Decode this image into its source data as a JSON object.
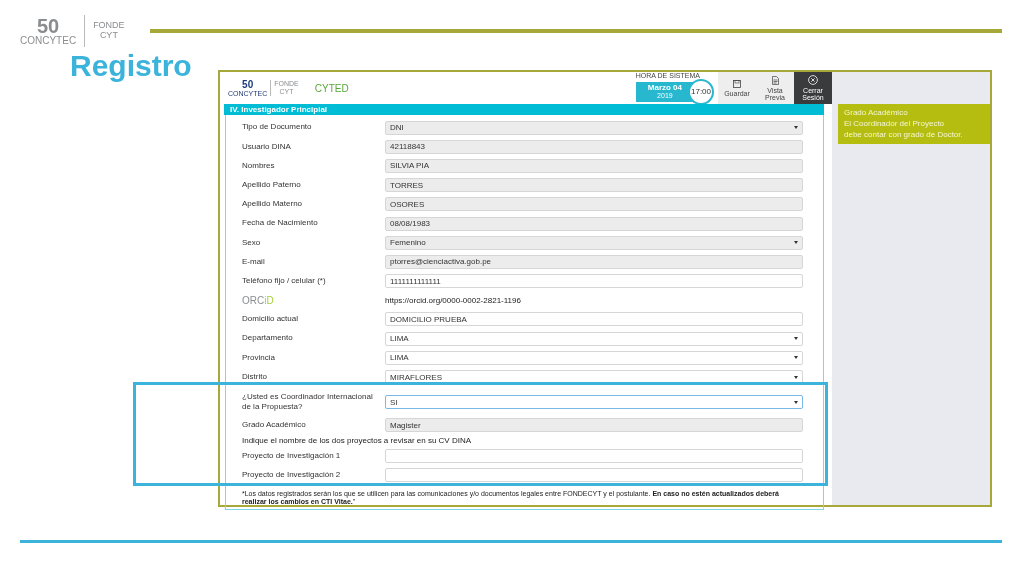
{
  "slide": {
    "logo": {
      "number": "50",
      "name": "CONCYTEC",
      "fund_top": "FONDE",
      "fund_bottom": "CYT"
    },
    "title": "Registro"
  },
  "app": {
    "logos": {
      "number": "50",
      "name": "CONCYTEC",
      "fund_top": "FONDE",
      "fund_bottom": "CYT",
      "partner": "CYTED"
    },
    "clock": {
      "label": "HORA DE SISTEMA",
      "date": "Marzo 04",
      "year": "2019",
      "time": "17:00"
    },
    "toolbar": [
      {
        "kind": "save",
        "label": "Guardar",
        "dark": false
      },
      {
        "kind": "preview",
        "label": "Vista Previa",
        "dark": false
      },
      {
        "kind": "close",
        "label": "Cerrar Sesión",
        "dark": true
      }
    ],
    "section": "IV. Investigador Principial",
    "rows": [
      {
        "kind": "select",
        "label": "Tipo de Documento",
        "value": "DNI",
        "disabled": true
      },
      {
        "kind": "input",
        "label": "Usuario DINA",
        "value": "42118843",
        "disabled": true
      },
      {
        "kind": "input",
        "label": "Nombres",
        "value": "SILVIA PIA",
        "disabled": true
      },
      {
        "kind": "input",
        "label": "Apellido Paterno",
        "value": "TORRES",
        "disabled": true
      },
      {
        "kind": "input",
        "label": "Apellido Materno",
        "value": "OSORES",
        "disabled": true
      },
      {
        "kind": "input",
        "label": "Fecha de Nacimiento",
        "value": "08/08/1983",
        "disabled": true
      },
      {
        "kind": "select",
        "label": "Sexo",
        "value": "Femenino",
        "disabled": true
      },
      {
        "kind": "input",
        "label": "E-mail",
        "value": "ptorres@cienciactiva.gob.pe",
        "disabled": true
      },
      {
        "kind": "input",
        "label": "Teléfono fijo / celular (*)",
        "value": "1111111111111",
        "disabled": false
      },
      {
        "kind": "orcid",
        "label_main": "ORC",
        "label_accent": "iD",
        "value": "https://orcid.org/0000-0002-2821-1196"
      },
      {
        "kind": "input",
        "label": "Domicilio actual",
        "value": "DOMICILIO PRUEBA",
        "disabled": false
      },
      {
        "kind": "select",
        "label": "Departamento",
        "value": "LIMA",
        "disabled": false
      },
      {
        "kind": "select",
        "label": "Provincia",
        "value": "LIMA",
        "disabled": false
      },
      {
        "kind": "select",
        "label": "Distrito",
        "value": "MIRAFLORES",
        "disabled": false
      },
      {
        "kind": "select",
        "label": "¿Usted es Coordinador Internacional de la Propuesta?",
        "value": "SI",
        "disabled": false
      },
      {
        "kind": "input",
        "label": "Grado Académico",
        "value": "Magister",
        "disabled": true
      },
      {
        "kind": "heading",
        "label": "Indique el nombre de los dos proyectos a revisar en su CV DINA"
      },
      {
        "kind": "input",
        "label": "Proyecto de Investigación 1",
        "value": "",
        "disabled": false
      },
      {
        "kind": "input",
        "label": "Proyecto de Investigación 2",
        "value": "",
        "disabled": false
      }
    ],
    "note": "*Los datos registrados serán los que se utilicen para las comunicaciones y/o documentos legales entre FONDECYT y el postulante. **En caso no estén actualizados deberá realizar los cambios en CTI Vitae.**\"",
    "tooltip": [
      "Grado Académico",
      "El Coordinador del Proyecto",
      "debe contar con grado de Doctor."
    ]
  }
}
